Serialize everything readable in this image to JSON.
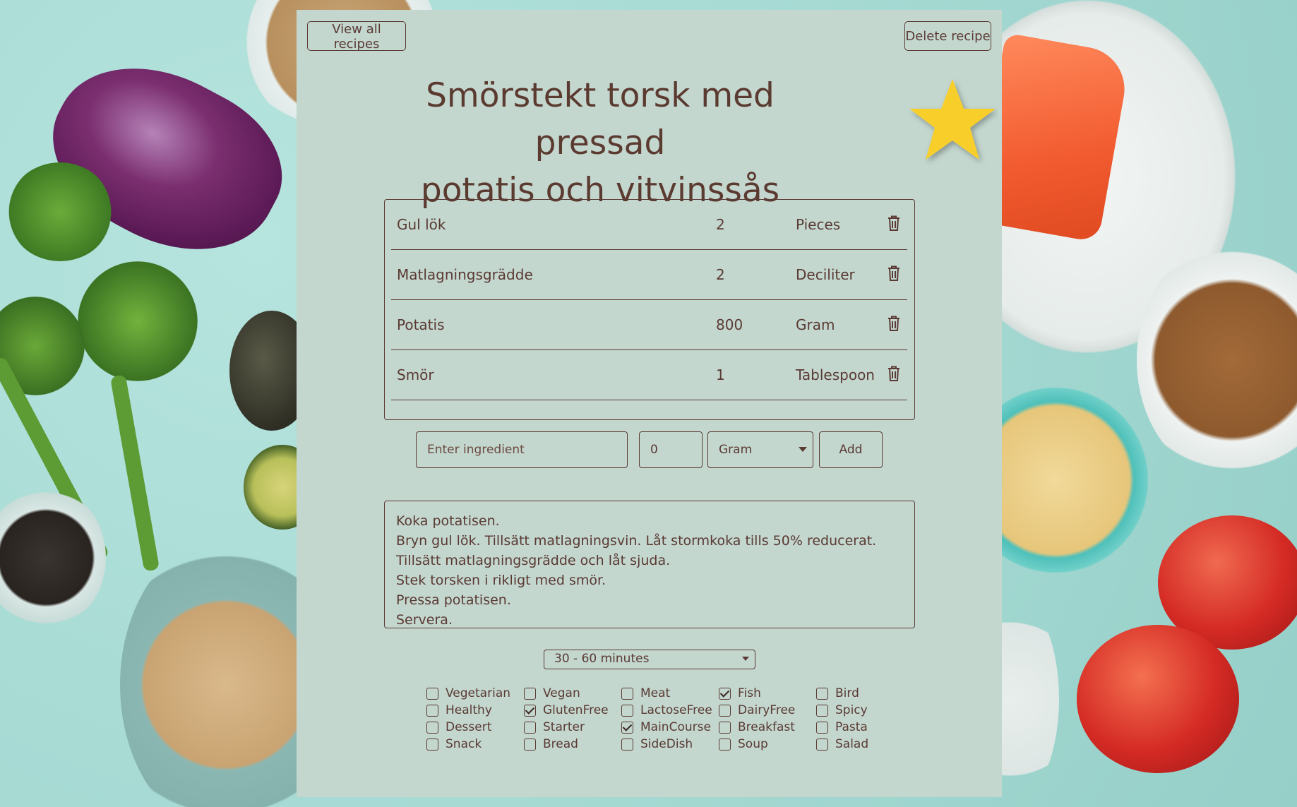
{
  "header": {
    "view_all_label": "View all recipes",
    "delete_label": "Delete recipe"
  },
  "recipe": {
    "title_line1": "Smörstekt torsk med pressad",
    "title_line2": "potatis och vitvinssås",
    "favorite": true
  },
  "ingredients": [
    {
      "name": "Gul lök",
      "quantity": "2",
      "unit": "Pieces"
    },
    {
      "name": "Matlagningsgrädde",
      "quantity": "2",
      "unit": "Deciliter"
    },
    {
      "name": "Potatis",
      "quantity": "800",
      "unit": "Gram"
    },
    {
      "name": "Smör",
      "quantity": "1",
      "unit": "Tablespoon"
    }
  ],
  "add_form": {
    "ingredient_placeholder": "Enter ingredient",
    "quantity_value": "0",
    "unit_selected": "Gram",
    "add_label": "Add"
  },
  "instructions": [
    "Koka potatisen.",
    "Bryn gul lök. Tillsätt matlagningsvin. Låt stormkoka tills 50% reducerat.",
    "Tillsätt matlagningsgrädde och låt sjuda.",
    "Stek torsken i rikligt med smör.",
    "Pressa potatisen.",
    "Servera."
  ],
  "time": {
    "selected": "30 - 60 minutes"
  },
  "tags": [
    {
      "label": "Vegetarian",
      "checked": false
    },
    {
      "label": "Vegan",
      "checked": false
    },
    {
      "label": "Meat",
      "checked": false
    },
    {
      "label": "Fish",
      "checked": true
    },
    {
      "label": "Bird",
      "checked": false
    },
    {
      "label": "Healthy",
      "checked": false
    },
    {
      "label": "GlutenFree",
      "checked": true
    },
    {
      "label": "LactoseFree",
      "checked": false
    },
    {
      "label": "DairyFree",
      "checked": false
    },
    {
      "label": "Spicy",
      "checked": false
    },
    {
      "label": "Dessert",
      "checked": false
    },
    {
      "label": "Starter",
      "checked": false
    },
    {
      "label": "MainCourse",
      "checked": true
    },
    {
      "label": "Breakfast",
      "checked": false
    },
    {
      "label": "Pasta",
      "checked": false
    },
    {
      "label": "Snack",
      "checked": false
    },
    {
      "label": "Bread",
      "checked": false
    },
    {
      "label": "SideDish",
      "checked": false
    },
    {
      "label": "Soup",
      "checked": false
    },
    {
      "label": "Salad",
      "checked": false
    }
  ],
  "colors": {
    "panel": "#c3d7cf",
    "text": "#5a3a33",
    "star": "#f8cf2c",
    "background": "#a9dcd6"
  }
}
